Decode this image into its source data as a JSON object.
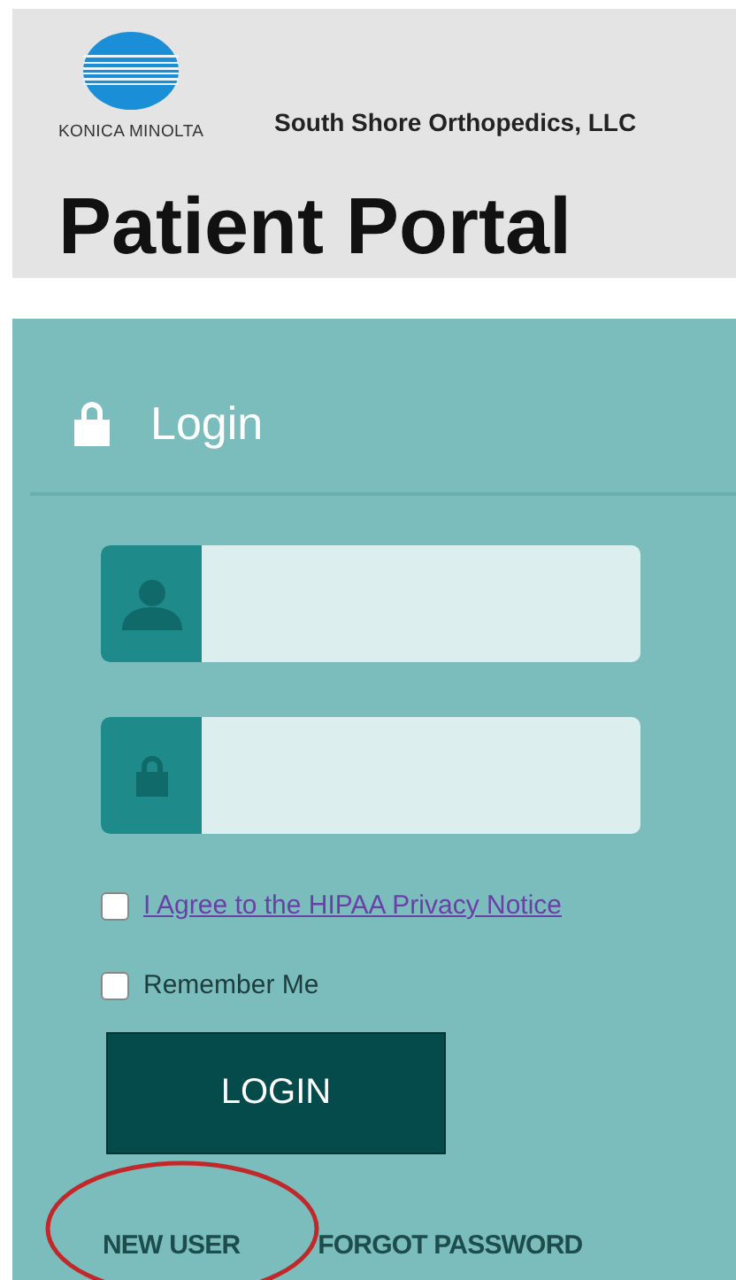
{
  "header": {
    "logo_text": "KONICA MINOLTA",
    "company": "South Shore Orthopedics, LLC",
    "title": "Patient Portal"
  },
  "login": {
    "title": "Login",
    "fields": [
      {
        "kind": "username"
      },
      {
        "kind": "password"
      }
    ],
    "checkboxes": [
      {
        "label": "I Agree to the HIPAA Privacy Notice",
        "kind": "link",
        "checked": false
      },
      {
        "label": "Remember Me",
        "kind": "plain",
        "checked": false
      }
    ],
    "button": "LOGIN",
    "links": [
      {
        "label": "NEW USER",
        "circled": true
      },
      {
        "label": "FORGOT PASSWORD",
        "circled": false
      }
    ]
  }
}
